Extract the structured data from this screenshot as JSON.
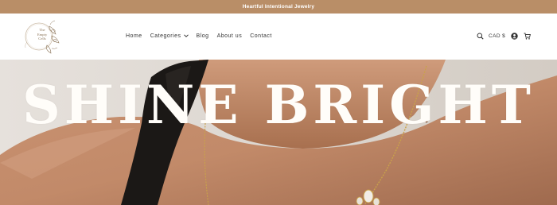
{
  "announcement": {
    "text": "Heartful Intentional Jewelry"
  },
  "logo": {
    "line1": "The",
    "line2": "Empty",
    "line3": "Cells"
  },
  "nav": {
    "items": [
      {
        "label": "Home"
      },
      {
        "label": "Categories"
      },
      {
        "label": "Blog"
      },
      {
        "label": "About us"
      },
      {
        "label": "Contact"
      }
    ]
  },
  "header": {
    "currency": "CAD $"
  },
  "hero": {
    "title": "SHINE BRIGHT"
  },
  "colors": {
    "announcement_bg": "#b98e67",
    "hero_title": "#fffdf9",
    "nav_text": "#333333"
  },
  "icons": [
    "search-icon",
    "account-icon",
    "cart-icon",
    "chevron-down-icon"
  ]
}
